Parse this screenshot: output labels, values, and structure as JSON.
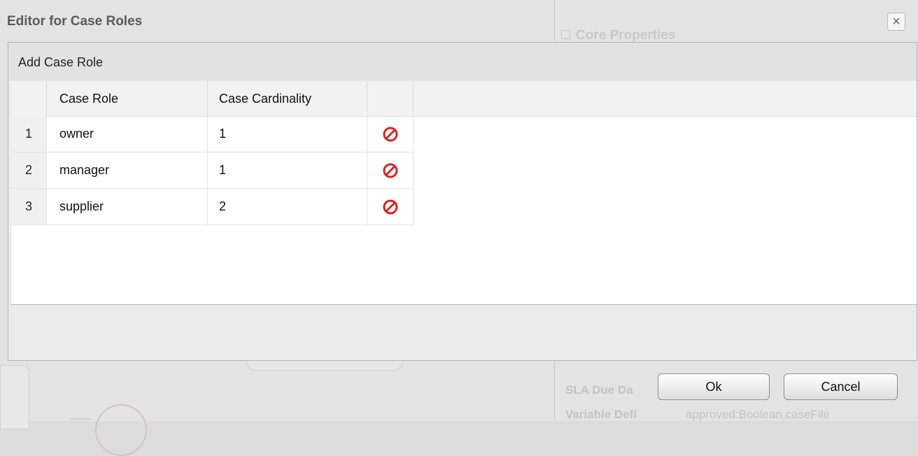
{
  "background": {
    "core_properties_title": "Core Properties",
    "sla_label": "SLA Due Da",
    "variable_label": "Variable Defi",
    "variable_value": "approved:Boolean,caseFile"
  },
  "dialog": {
    "title": "Editor for Case Roles",
    "close_glyph": "×"
  },
  "toolbar": {
    "add_label": "Add Case Role"
  },
  "grid": {
    "columns": [
      "Case Role",
      "Case Cardinality"
    ],
    "rows": [
      {
        "num": "1",
        "role": "owner",
        "cardinality": "1"
      },
      {
        "num": "2",
        "role": "manager",
        "cardinality": "1"
      },
      {
        "num": "3",
        "role": "supplier",
        "cardinality": "2"
      }
    ],
    "delete_icon": "delete-icon",
    "delete_color": "#e02020"
  },
  "buttons": {
    "ok": "Ok",
    "cancel": "Cancel"
  }
}
